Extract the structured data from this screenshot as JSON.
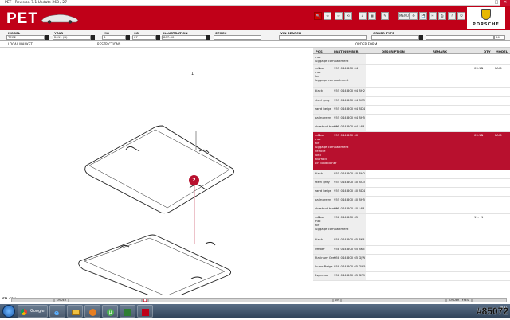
{
  "window": {
    "title": "PET - Revision 7.1 Update 268 / 27",
    "min": "–",
    "max": "□",
    "close": "✕"
  },
  "header": {
    "logo": "PET",
    "brand": "PORSCHE",
    "toolbar_buttons": [
      "🔍",
      "⇦",
      "⇨",
      "⟲",
      "⌂",
      "▦",
      "✎",
      "MENU",
      "⚙",
      "💾",
      "✂",
      "⎙",
      "?",
      "⏻",
      "⚠",
      "✉",
      "⌕",
      "▢",
      "✕"
    ]
  },
  "fields": {
    "model_label": "MODEL",
    "model_value": "TEG2",
    "year_label": "YEAR",
    "year_value": "2011 (B)",
    "mg_label": "MG",
    "mg_value": "8",
    "sg_label": "SG",
    "sg_value": "07",
    "illustration_label": "ILLUSTRATION",
    "illustration_value": "807-00",
    "stock_label": "STOCK",
    "vin_label": "VIN SEARCH",
    "order_type_label": "ORDER TYPE",
    "order_qty": "94"
  },
  "subheader": {
    "local_market": "LOCAL MARKET",
    "restrictions": "RESTRICTIONS",
    "order_form": "ORDER FORM"
  },
  "drawing": {
    "callout1": "1",
    "callout2": "2"
  },
  "table": {
    "headers": {
      "pos": "POS",
      "part_number": "PART NUMBER",
      "description": "DESCRIPTION",
      "remark": "REMARK",
      "qty": "QTY",
      "model": "MODEL"
    },
    "rows": [
      {
        "pos": "",
        "pn": "",
        "desc": [
          "mat",
          "luggage compartment"
        ],
        "remark": "",
        "qty": "",
        "model": "",
        "h": 14,
        "sel": false
      },
      {
        "pos": "1",
        "pn": "955 044 800 04",
        "desc": [
          "velour",
          "mat",
          "for",
          "luggage compartment"
        ],
        "remark": "03.10",
        "qty": "1",
        "model": "PAID",
        "h": 28,
        "sel": false
      },
      {
        "pos": "",
        "pn": "955 044 800 04 8H2",
        "desc": [
          "black"
        ],
        "remark": "",
        "qty": "",
        "model": "",
        "h": 12,
        "sel": false
      },
      {
        "pos": "",
        "pn": "955 044 800 04 8C3",
        "desc": [
          "steel grey"
        ],
        "remark": "",
        "qty": "",
        "model": "",
        "h": 11,
        "sel": false
      },
      {
        "pos": "",
        "pn": "955 044 800 04 8D4",
        "desc": [
          "sand beige"
        ],
        "remark": "",
        "qty": "",
        "model": "",
        "h": 11,
        "sel": false
      },
      {
        "pos": "",
        "pn": "955 044 800 04 8H5",
        "desc": [
          "palmgreen"
        ],
        "remark": "",
        "qty": "",
        "model": "",
        "h": 11,
        "sel": false
      },
      {
        "pos": "",
        "pn": "955 044 800 04 L63",
        "desc": [
          "chestnut brown"
        ],
        "remark": "",
        "qty": "",
        "model": "",
        "h": 11,
        "sel": false
      },
      {
        "pos": "2",
        "pn": "955 044 800 40",
        "desc": [
          "velour",
          "mat",
          "for",
          "luggage compartment",
          "vehicle",
          "with",
          "fourfold",
          "air conditioner"
        ],
        "remark": "03.10",
        "qty": "1",
        "model": "PAID",
        "h": 48,
        "sel": true
      },
      {
        "pos": "",
        "pn": "955 044 800 40 8H2",
        "desc": [
          "black"
        ],
        "remark": "",
        "qty": "",
        "model": "",
        "h": 11,
        "sel": false
      },
      {
        "pos": "",
        "pn": "955 044 800 40 8C3",
        "desc": [
          "steel grey"
        ],
        "remark": "",
        "qty": "",
        "model": "",
        "h": 11,
        "sel": false
      },
      {
        "pos": "",
        "pn": "955 044 800 40 8D4",
        "desc": [
          "sand beige"
        ],
        "remark": "",
        "qty": "",
        "model": "",
        "h": 11,
        "sel": false
      },
      {
        "pos": "",
        "pn": "955 044 800 40 8H5",
        "desc": [
          "palmgreen"
        ],
        "remark": "",
        "qty": "",
        "model": "",
        "h": 11,
        "sel": false
      },
      {
        "pos": "",
        "pn": "955 044 800 40 L63",
        "desc": [
          "chestnut brown"
        ],
        "remark": "",
        "qty": "",
        "model": "",
        "h": 11,
        "sel": false
      },
      {
        "pos": "2",
        "pn": "958 044 800 65",
        "desc": [
          "velour",
          "mat",
          "for",
          "luggage compartment"
        ],
        "remark": "11.",
        "qty": "1",
        "model": "",
        "h": 28,
        "sel": false
      },
      {
        "pos": "",
        "pn": "958 044 800 65 8K4",
        "desc": [
          "black"
        ],
        "remark": "",
        "qty": "",
        "model": "",
        "h": 12,
        "sel": false
      },
      {
        "pos": "",
        "pn": "958 044 800 65 8K5",
        "desc": [
          "Umber"
        ],
        "remark": "",
        "qty": "",
        "model": "",
        "h": 11,
        "sel": false
      },
      {
        "pos": "",
        "pn": "958 044 800 65 DJW",
        "desc": [
          "Platinum Grey"
        ],
        "remark": "",
        "qty": "",
        "model": "",
        "h": 11,
        "sel": false
      },
      {
        "pos": "",
        "pn": "958 044 800 65 DN5",
        "desc": [
          "Luxor Beige"
        ],
        "remark": "",
        "qty": "",
        "model": "",
        "h": 11,
        "sel": false
      },
      {
        "pos": "",
        "pn": "958 044 800 65 DP9",
        "desc": [
          "Espresso"
        ],
        "remark": "",
        "qty": "",
        "model": "",
        "h": 11,
        "sel": false
      }
    ]
  },
  "footer": {
    "left_label": "STL CON",
    "order_label": "ORDER",
    "vin_label": "VIN",
    "order_types_label": "ORDER TYPES"
  },
  "taskbar": {
    "google": "Google",
    "clock": "",
    "watermark": "#85072"
  },
  "colors": {
    "accent": "#c00018",
    "selected_row": "#b8102e"
  }
}
